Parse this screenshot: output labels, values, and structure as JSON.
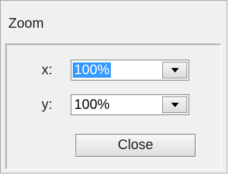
{
  "window": {
    "title": "Zoom"
  },
  "zoom_x": {
    "label": "x:",
    "value": "100%"
  },
  "zoom_y": {
    "label": "y:",
    "value": "100%"
  },
  "buttons": {
    "close_label": "Close"
  },
  "icons": {
    "dropdown": "chevron-down-icon"
  },
  "colors": {
    "selection": "#3399ff",
    "window_bg": "#f0f0f0"
  }
}
